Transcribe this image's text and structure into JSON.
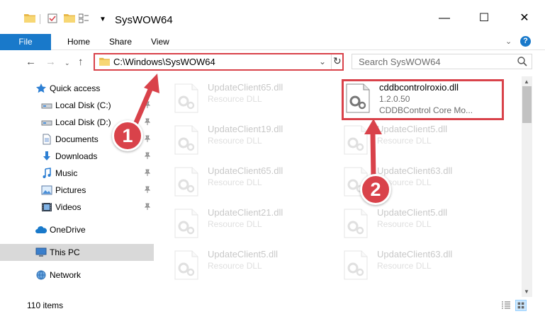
{
  "window": {
    "title": "SysWOW64",
    "minimize": "—",
    "maximize": "☐",
    "close": "✕"
  },
  "ribbon": {
    "tabs": [
      {
        "label": "File"
      },
      {
        "label": "Home"
      },
      {
        "label": "Share"
      },
      {
        "label": "View"
      }
    ],
    "help_label": "?"
  },
  "navigation": {
    "back": "←",
    "forward": "→",
    "recent": "⌄",
    "up": "↑",
    "address": "C:\\Windows\\SysWOW64",
    "address_caret": "⌄",
    "refresh": "↻",
    "search_placeholder": "Search SysWOW64"
  },
  "sidebar": {
    "items": [
      {
        "label": "Quick access",
        "icon": "star-icon",
        "pinned": false
      },
      {
        "label": "Local Disk (C:)",
        "icon": "drive-icon",
        "pinned": true
      },
      {
        "label": "Local Disk (D:)",
        "icon": "drive-icon",
        "pinned": true
      },
      {
        "label": "Documents",
        "icon": "documents-icon",
        "pinned": true
      },
      {
        "label": "Downloads",
        "icon": "downloads-icon",
        "pinned": true
      },
      {
        "label": "Music",
        "icon": "music-icon",
        "pinned": true
      },
      {
        "label": "Pictures",
        "icon": "pictures-icon",
        "pinned": true
      },
      {
        "label": "Videos",
        "icon": "videos-icon",
        "pinned": true
      },
      {
        "label": "OneDrive",
        "icon": "onedrive-icon",
        "pinned": false
      },
      {
        "label": "This PC",
        "icon": "computer-icon",
        "pinned": false,
        "selected": true
      },
      {
        "label": "Network",
        "icon": "network-icon",
        "pinned": false
      }
    ]
  },
  "files": [
    {
      "name": "UpdateClient65.dll",
      "line2": "Resource DLL",
      "line3": "",
      "faded": true
    },
    {
      "name": "cddbcontrolroxio.dll",
      "line2": "1.2.0.50",
      "line3": "CDDBControl Core Mo...",
      "faded": false
    },
    {
      "name": "UpdateClient19.dll",
      "line2": "Resource DLL",
      "line3": "",
      "faded": true
    },
    {
      "name": "UpdateClient5.dll",
      "line2": "Resource DLL",
      "line3": "",
      "faded": true
    },
    {
      "name": "UpdateClient65.dll",
      "line2": "Resource DLL",
      "line3": "",
      "faded": true
    },
    {
      "name": "UpdateClient63.dll",
      "line2": "Resource DLL",
      "line3": "",
      "faded": true
    },
    {
      "name": "UpdateClient21.dll",
      "line2": "Resource DLL",
      "line3": "",
      "faded": true
    },
    {
      "name": "UpdateClient5.dll",
      "line2": "Resource DLL",
      "line3": "",
      "faded": true
    },
    {
      "name": "UpdateClient5.dll",
      "line2": "Resource DLL",
      "line3": "",
      "faded": true
    },
    {
      "name": "UpdateClient63.dll",
      "line2": "Resource DLL",
      "line3": "",
      "faded": true
    }
  ],
  "status": {
    "item_count": "110 items"
  },
  "annotations": {
    "marker_1": "1",
    "marker_2": "2",
    "color": "#d9424a"
  },
  "colors": {
    "accent": "#1979ca",
    "selection": "#d9d9d9",
    "annotation": "#d9424a"
  }
}
